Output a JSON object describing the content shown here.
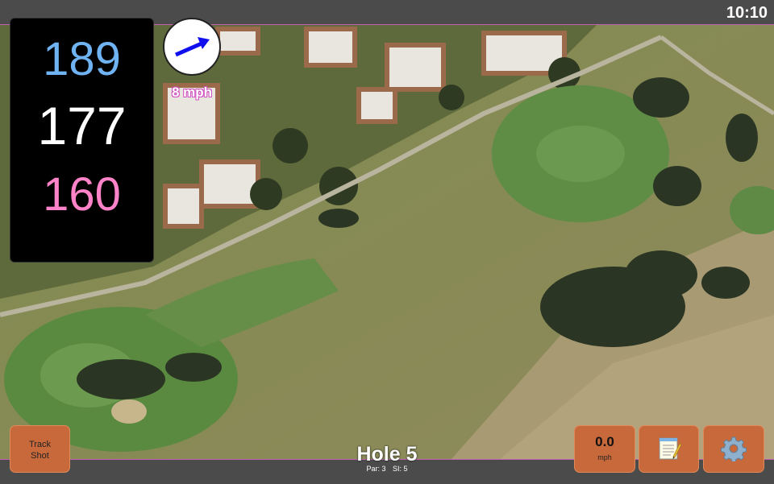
{
  "status": {
    "time": "10:10"
  },
  "yardages": {
    "back": "189",
    "middle": "177",
    "front": "160"
  },
  "wind": {
    "speed_label": "8 mph",
    "arrow_color": "#1010ee"
  },
  "hole": {
    "title": "Hole 5",
    "par": "Par: 3",
    "stroke_index": "SI: 5"
  },
  "buttons": {
    "track_shot": {
      "line1": "Track",
      "line2": "Shot"
    },
    "speed": {
      "value": "0.0",
      "unit": "mph"
    },
    "notes_icon": "notepad-icon",
    "settings_icon": "gear-icon"
  },
  "colors": {
    "back_yardage": "#6fb3f2",
    "middle_yardage": "#ffffff",
    "front_yardage": "#ff83c8",
    "button": "#c8693b",
    "bar": "#4b4b4b",
    "accent_line": "#c060b0"
  }
}
